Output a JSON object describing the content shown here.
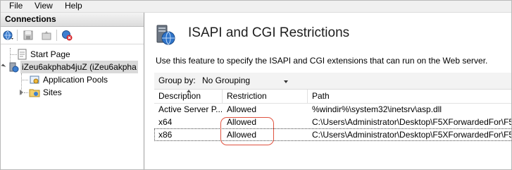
{
  "menu": {
    "file": "File",
    "view": "View",
    "help": "Help"
  },
  "connections": {
    "header": "Connections",
    "tree": {
      "start_page": "Start Page",
      "server": "iZeu6akphab4juZ (iZeu6akpha",
      "app_pools": "Application Pools",
      "sites": "Sites"
    }
  },
  "feature": {
    "title": "ISAPI and CGI Restrictions",
    "description": "Use this feature to specify the ISAPI and CGI extensions that can run on the Web server.",
    "group_by_label": "Group by:",
    "group_by_value": "No Grouping"
  },
  "table": {
    "columns": [
      "Description",
      "Restriction",
      "Path"
    ],
    "rows": [
      {
        "description": "Active Server P...",
        "restriction": "Allowed",
        "path": "%windir%\\system32\\inetsrv\\asp.dll"
      },
      {
        "description": "x64",
        "restriction": "Allowed",
        "path": "C:\\Users\\Administrator\\Desktop\\F5XForwardedFor\\F5"
      },
      {
        "description": "x86",
        "restriction": "Allowed",
        "path": "C:\\Users\\Administrator\\Desktop\\F5XForwardedFor\\F5"
      }
    ]
  },
  "colors": {
    "annotation": "#e0523f",
    "selection": "#dadada",
    "header_gradient": "#dcdcdc"
  }
}
